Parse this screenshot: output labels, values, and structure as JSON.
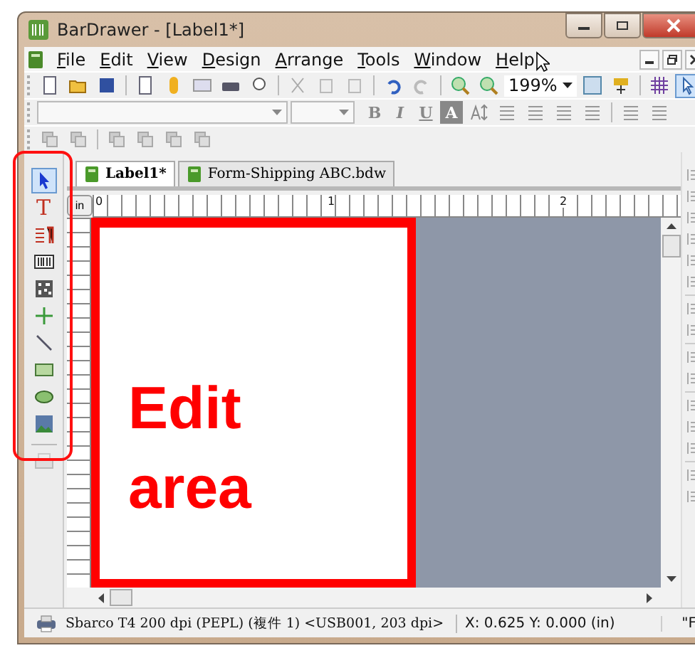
{
  "window": {
    "title": "BarDrawer - [Label1*]"
  },
  "menu": [
    "File",
    "Edit",
    "View",
    "Design",
    "Arrange",
    "Tools",
    "Window",
    "Help"
  ],
  "toolbar": {
    "zoom": "199%",
    "pointer_selected": true
  },
  "format_bar": {
    "buttons": [
      {
        "label": "B",
        "kind": "bold"
      },
      {
        "label": "I",
        "kind": "italic"
      },
      {
        "label": "U",
        "kind": "underline"
      },
      {
        "label": "A",
        "kind": "inverse"
      }
    ]
  },
  "toolbox": [
    {
      "kind": "pointer",
      "selected": true
    },
    {
      "kind": "text",
      "label": "T",
      "selected": false
    },
    {
      "kind": "paragraph",
      "selected": false
    },
    {
      "kind": "barcode",
      "selected": false
    },
    {
      "kind": "qrcode",
      "selected": false
    },
    {
      "kind": "cross",
      "selected": false
    },
    {
      "kind": "line",
      "selected": false
    },
    {
      "kind": "rectangle",
      "selected": false
    },
    {
      "kind": "ellipse",
      "selected": false
    },
    {
      "kind": "picture",
      "selected": false
    }
  ],
  "tabs": [
    {
      "label": "Label1*",
      "selected": true
    },
    {
      "label": "Form-Shipping ABC.bdw",
      "selected": false
    }
  ],
  "ruler": {
    "unit": "in",
    "marks": [
      "0",
      "1",
      "2"
    ]
  },
  "annotation": {
    "lines": [
      "Edit",
      "area"
    ]
  },
  "status_bar": {
    "printer": "Sbarco T4 200 dpi (PEPL) (複件 1) <USB001, 203 dpi>",
    "coordinates": "X: 0.625  Y: 0.000 (in)",
    "extra": "\"F"
  }
}
